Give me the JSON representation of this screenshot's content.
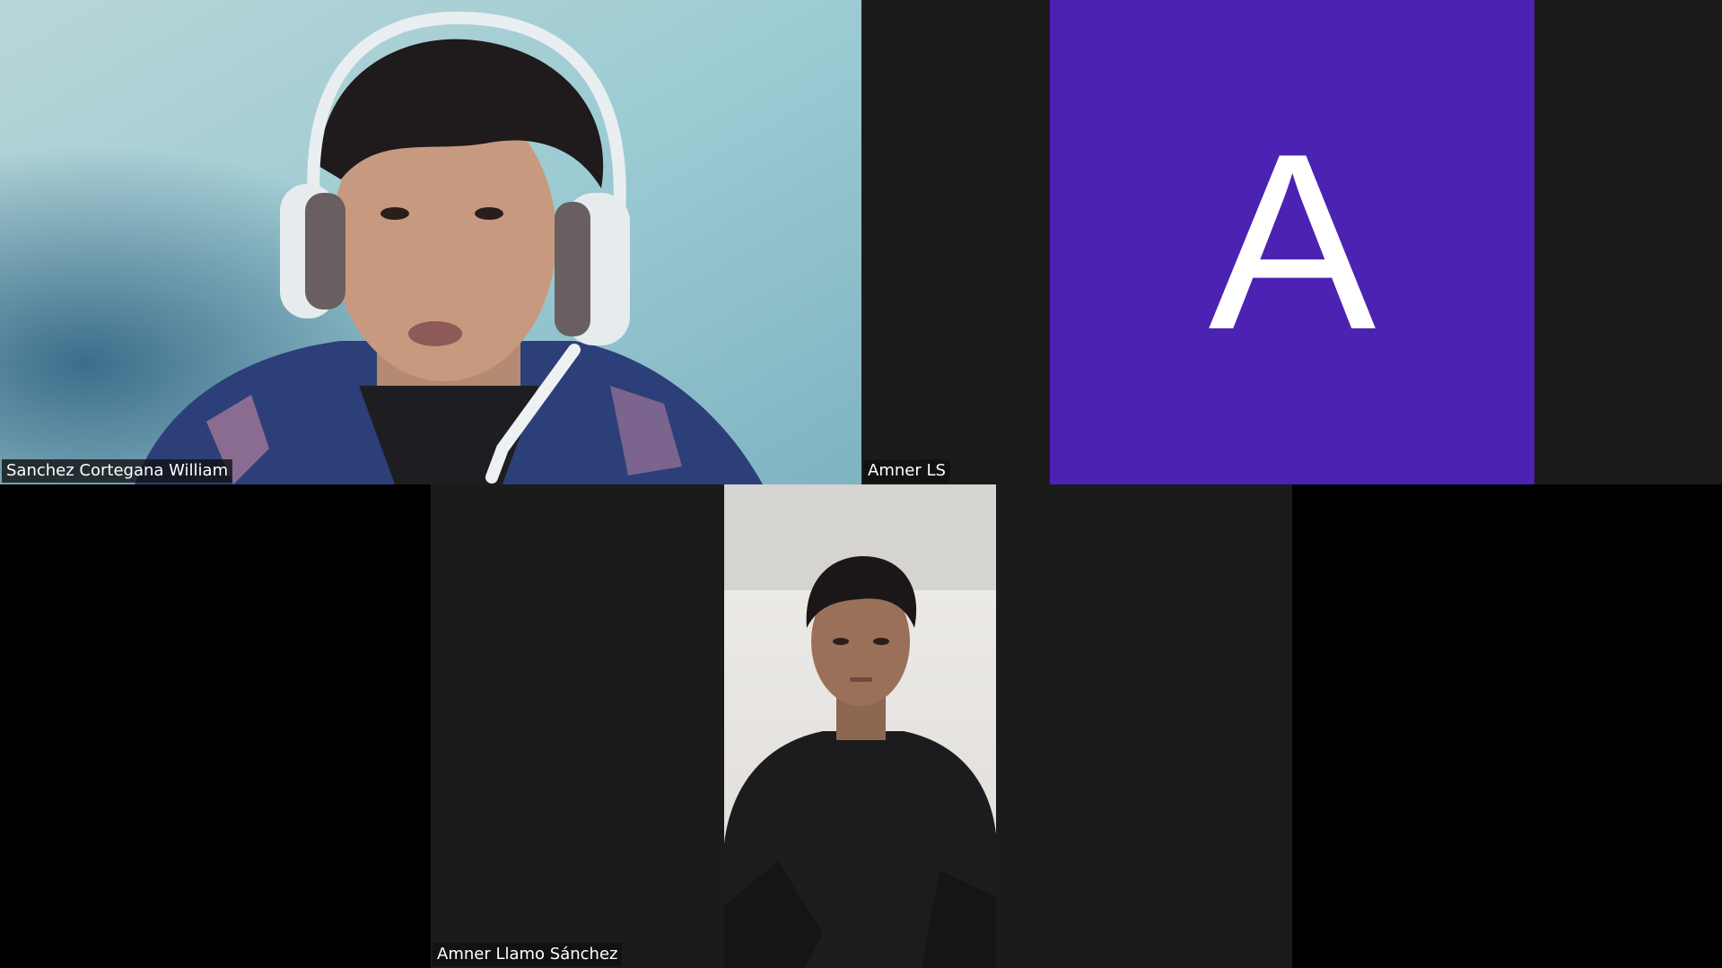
{
  "participants": [
    {
      "name": "Sanchez Cortegana William",
      "video": "camera-on-headset"
    },
    {
      "name": "Amner LS",
      "video": "avatar",
      "avatar": {
        "initial": "A",
        "color": "#4c22b2"
      }
    },
    {
      "name": "Amner Llamo Sánchez",
      "video": "camera-on"
    }
  ],
  "colors": {
    "background": "#000000",
    "tile": "#1b1b1b",
    "label_bg": "#101010",
    "label_text": "#ffffff"
  }
}
